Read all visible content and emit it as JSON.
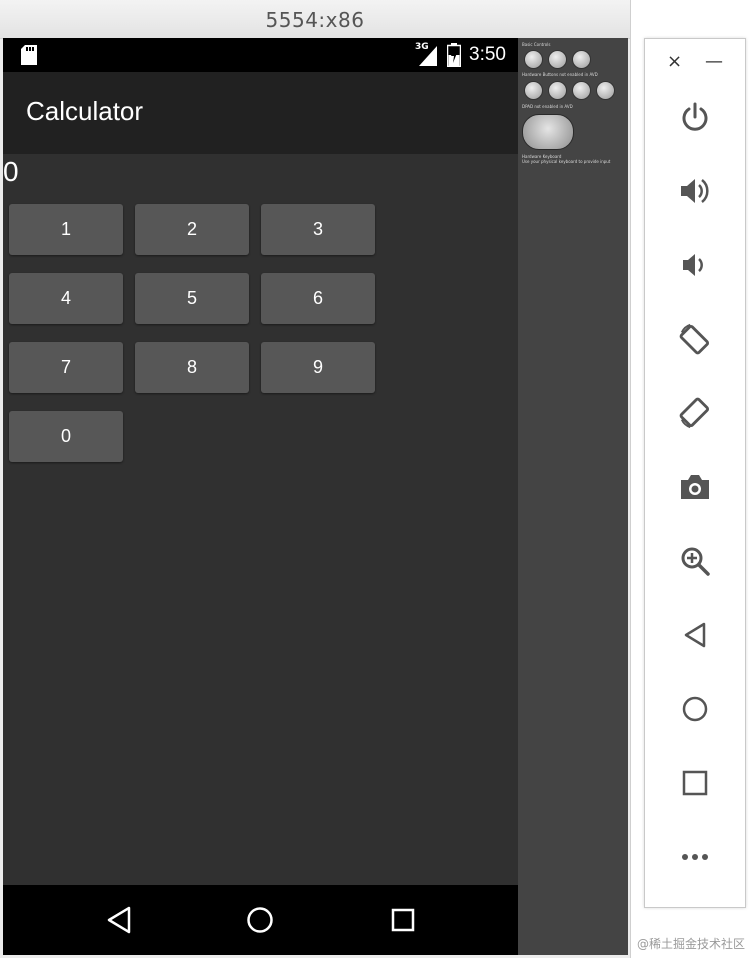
{
  "window": {
    "title": "5554:x86"
  },
  "statusbar": {
    "network": "3G",
    "time": "3:50"
  },
  "app": {
    "title": "Calculator",
    "display_value": "0"
  },
  "keypad": {
    "keys": [
      "1",
      "2",
      "3",
      "4",
      "5",
      "6",
      "7",
      "8",
      "9",
      "0"
    ]
  },
  "navbar": {
    "icons": [
      "back-icon",
      "home-icon",
      "recents-icon"
    ]
  },
  "skin_panel": {
    "basic_controls": "Basic Controls",
    "hardware_buttons": "Hardware Buttons not enabled in AVD",
    "dpad": "DPAD not enabled in AVD",
    "hardware_keyboard": "Hardware Keyboard",
    "keyboard_hint": "Use your physical keyboard to provide input"
  },
  "toolbar": {
    "close": "×",
    "minimize": "—",
    "icons": [
      "power-icon",
      "volume-up-icon",
      "volume-down-icon",
      "rotate-left-icon",
      "rotate-right-icon",
      "camera-icon",
      "zoom-icon",
      "back-icon",
      "home-icon",
      "overview-icon",
      "more-icon"
    ]
  },
  "watermark": "@稀土掘金技术社区"
}
